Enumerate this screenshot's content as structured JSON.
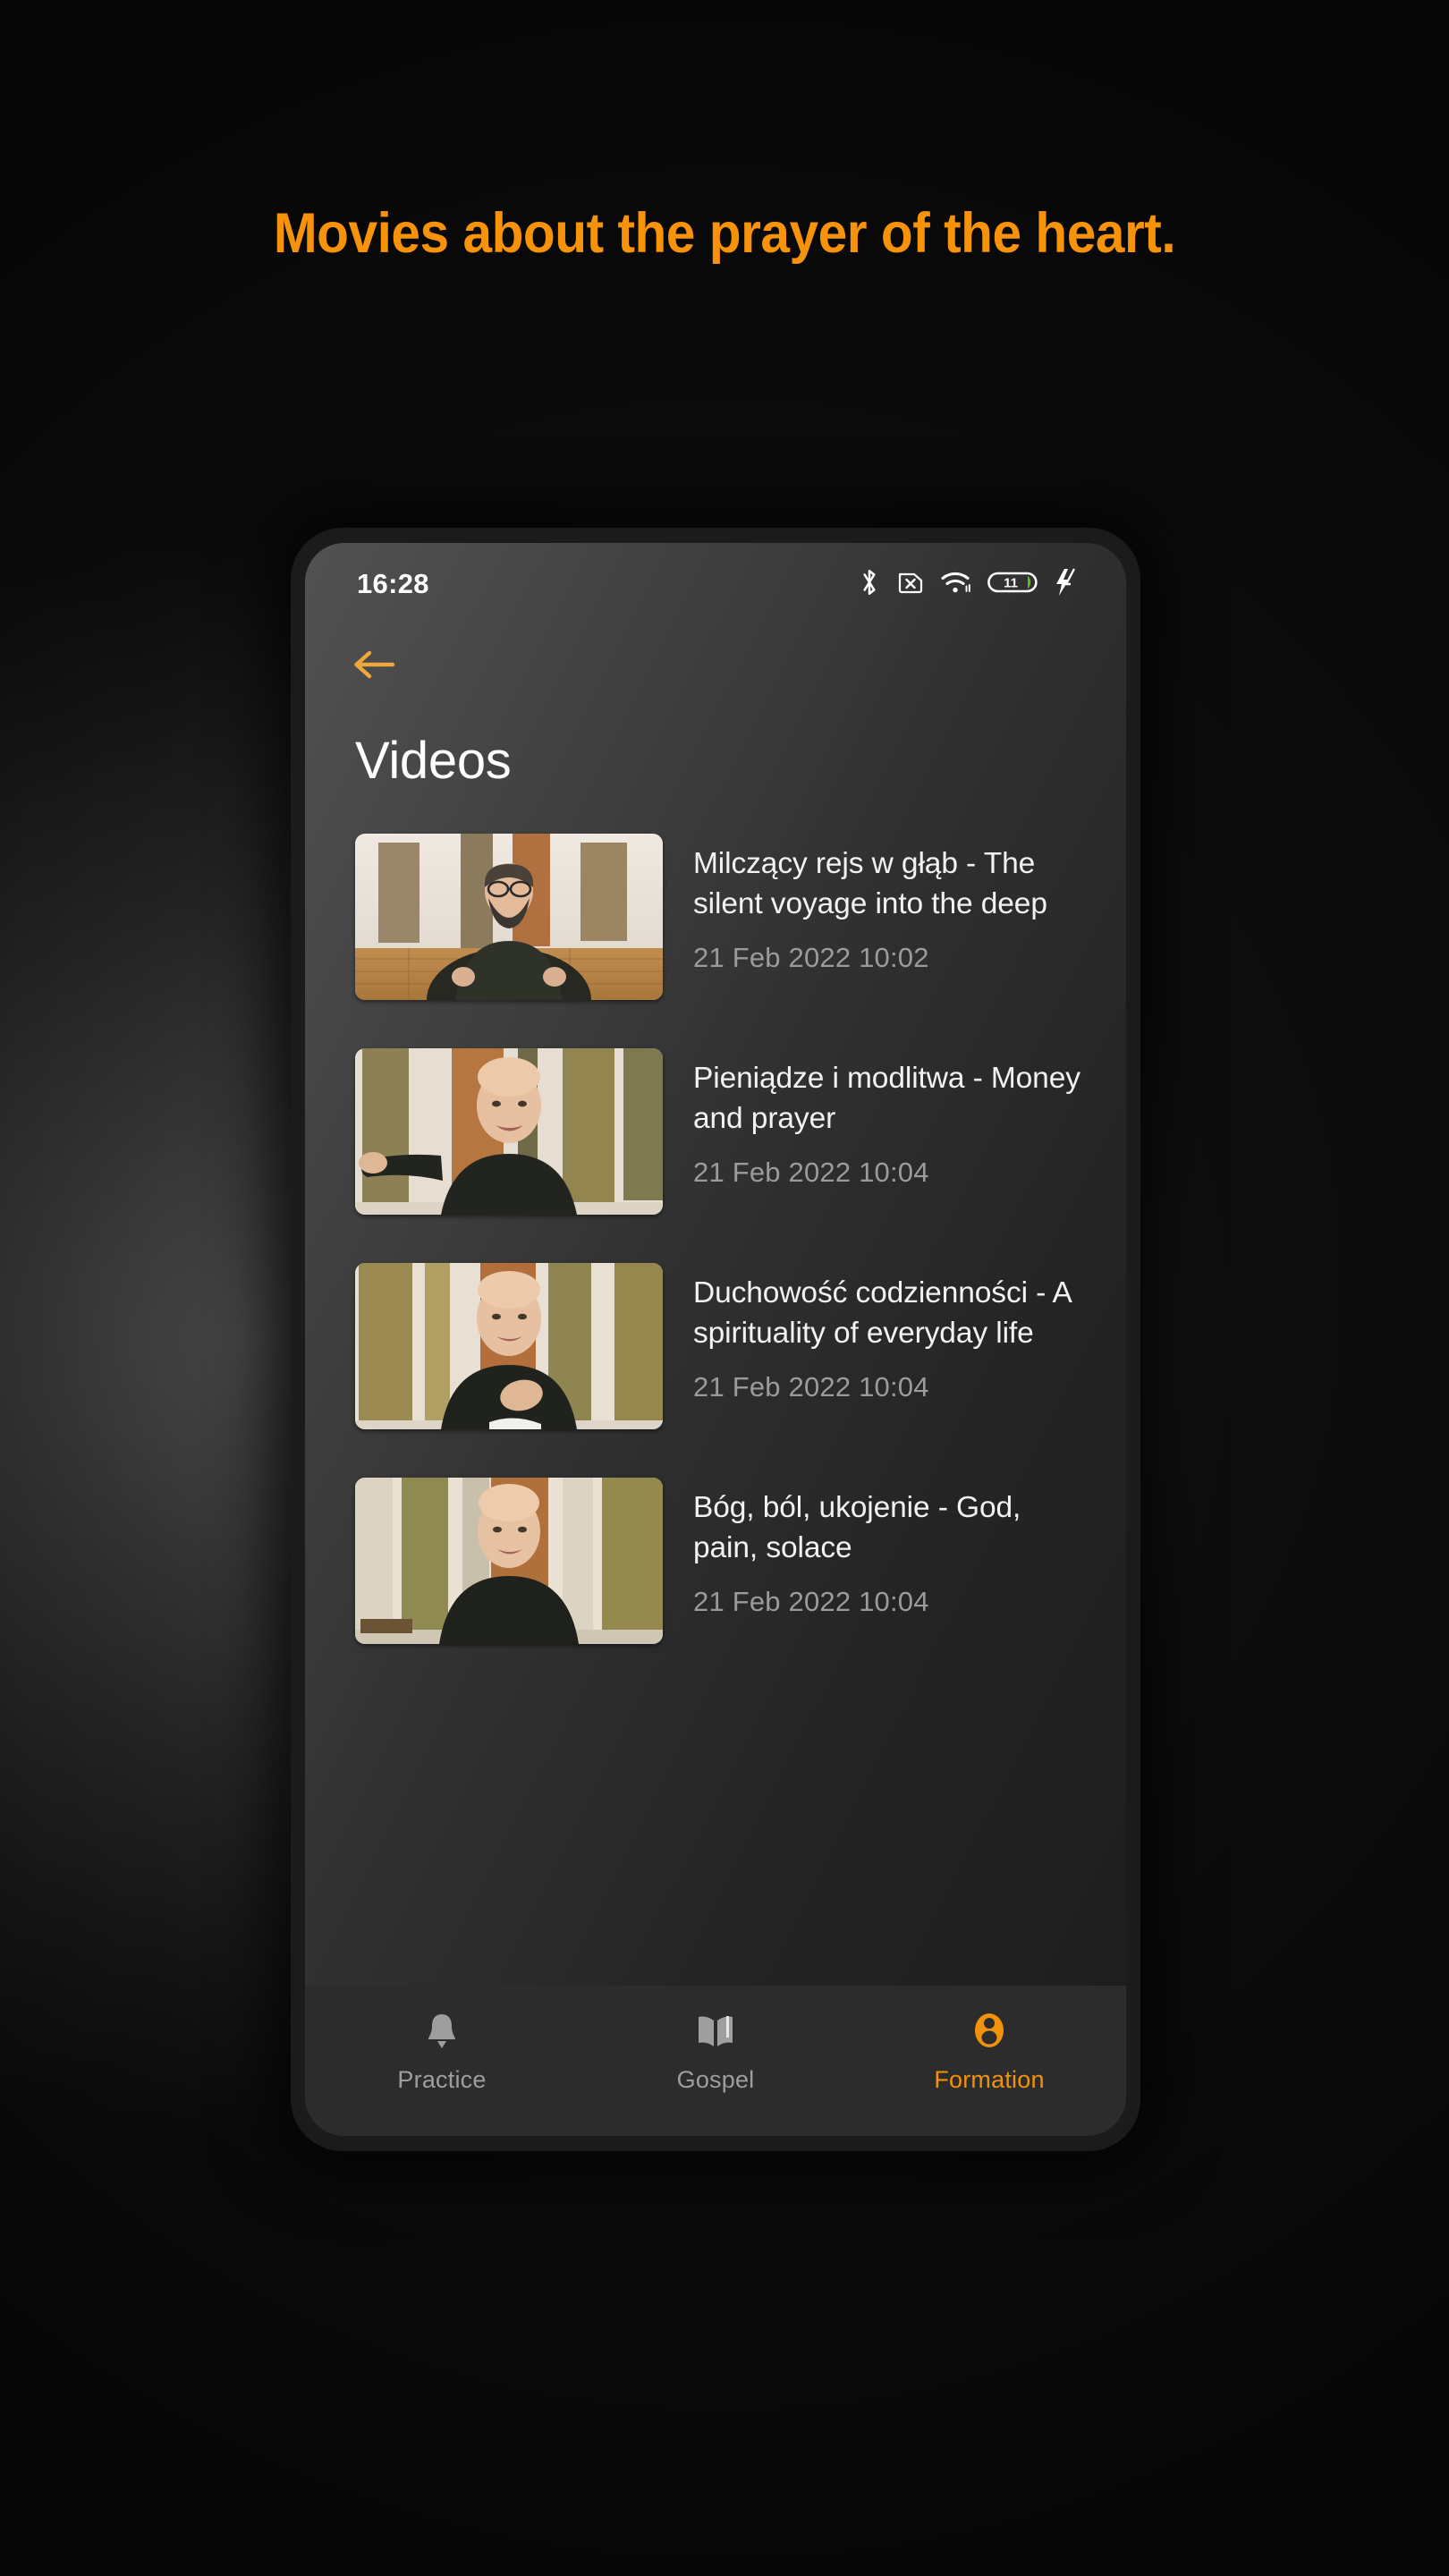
{
  "promo": {
    "headline": "Movies about the prayer of the heart.",
    "headline_color": "#F7920B"
  },
  "phone": {
    "statusbar": {
      "time": "16:28",
      "icons": [
        {
          "name": "bluetooth-icon",
          "label": "Bluetooth"
        },
        {
          "name": "sim-missing-icon",
          "label": "No SIM"
        },
        {
          "name": "wifi-icon",
          "label": "Wi-Fi"
        },
        {
          "name": "battery-icon",
          "label": "Battery",
          "level_text": "11"
        },
        {
          "name": "charging-bolt-icon",
          "label": "Charging"
        }
      ],
      "battery_level": "11",
      "battery_fill_color": "#56C11E"
    },
    "appbar": {
      "back_label": "Back",
      "back_icon": "arrow-left-icon",
      "accent_color": "#F0A73C"
    },
    "screen": {
      "title": "Videos"
    },
    "videos": [
      {
        "title": "Milczący rejs w głąb - The silent voyage into the deep",
        "date": "21 Feb 2022",
        "time": "10:02",
        "meta": "21 Feb 2022  10:02",
        "thumb": "monk-seated-meditating"
      },
      {
        "title": "Pieniądze i modlitwa - Money and prayer",
        "date": "21 Feb 2022",
        "time": "10:04",
        "meta": "21 Feb 2022  10:04",
        "thumb": "monk-gesturing-hand-out"
      },
      {
        "title": "Duchowość codzienności - A spirituality of everyday life",
        "date": "21 Feb 2022",
        "time": "10:04",
        "meta": "21 Feb 2022  10:04",
        "thumb": "monk-hand-on-chest"
      },
      {
        "title": "Bóg, ból, ukojenie - God, pain, solace",
        "date": "21 Feb 2022",
        "time": "10:04",
        "meta": "21 Feb 2022  10:04",
        "thumb": "monk-standing-smiling"
      }
    ],
    "bottom_nav": {
      "active_color": "#F0920B",
      "inactive_color": "#9E9E9E",
      "items": [
        {
          "label": "Practice",
          "icon": "bell-icon",
          "active": false
        },
        {
          "label": "Gospel",
          "icon": "book-icon",
          "active": false
        },
        {
          "label": "Formation",
          "icon": "person-icon",
          "active": true
        }
      ]
    }
  }
}
